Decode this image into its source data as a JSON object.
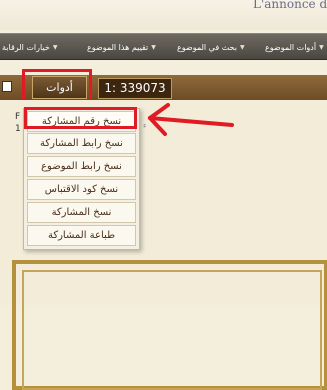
{
  "banner": {
    "text": "L'annonce d"
  },
  "navbar": {
    "items": [
      {
        "label": "خيارات الرقابة"
      },
      {
        "label": "تقييم هذا الموضوع"
      },
      {
        "label": "بحث في الموضوع"
      },
      {
        "label": "أدوات الموضوع"
      }
    ]
  },
  "post": {
    "number_text": "339073 :1"
  },
  "tools": {
    "label": "أدوات"
  },
  "menu": {
    "items": [
      {
        "label": "نسخ رقم المشاركة"
      },
      {
        "label": "نسخ رابط المشاركة"
      },
      {
        "label": "نسخ رابط الموضوع"
      },
      {
        "label": "نسخ كود الاقتباس"
      },
      {
        "label": "نسخ المشاركة"
      },
      {
        "label": "طباعة المشاركة"
      }
    ]
  },
  "colors": {
    "highlight": "#e01b24",
    "menu_text": "#4a2e1a",
    "navbar": "#5c5850"
  }
}
